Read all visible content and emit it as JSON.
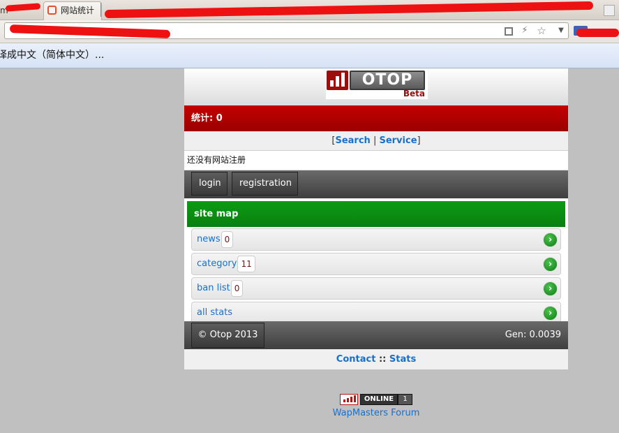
{
  "browser": {
    "left_tab_fragment": "m",
    "active_tab_title": "网站统计",
    "infobar_text": "译成中文（简体中文）..."
  },
  "header": {
    "logo_text": "OTOP",
    "logo_badge": "Beta"
  },
  "stats_bar": {
    "label": "统计: 0"
  },
  "top_links": {
    "open": "[",
    "search": "Search",
    "sep": " | ",
    "service": "Service",
    "close": "]"
  },
  "notice": "还没有网站注册",
  "auth": {
    "login": "login",
    "registration": "registration"
  },
  "sitemap": {
    "title": "site map",
    "items": [
      {
        "label": "news",
        "count": "0"
      },
      {
        "label": "category",
        "count": "11"
      },
      {
        "label": "ban list",
        "count": "0"
      },
      {
        "label": "all stats",
        "count": null
      }
    ]
  },
  "footer": {
    "copyright": "© Otop 2013",
    "gen": "Gen: 0.0039"
  },
  "bottom_links": {
    "contact": "Contact",
    "sep": " :: ",
    "stats": "Stats"
  },
  "online_counter": {
    "label": "ONLINE",
    "count": "1"
  },
  "forum_link": "WapMasters Forum",
  "colors": {
    "stats_bar": "#b40000",
    "sitemap_header": "#0a8f12",
    "link": "#1a6fc9",
    "dark_bar": "#4a4a4a"
  }
}
